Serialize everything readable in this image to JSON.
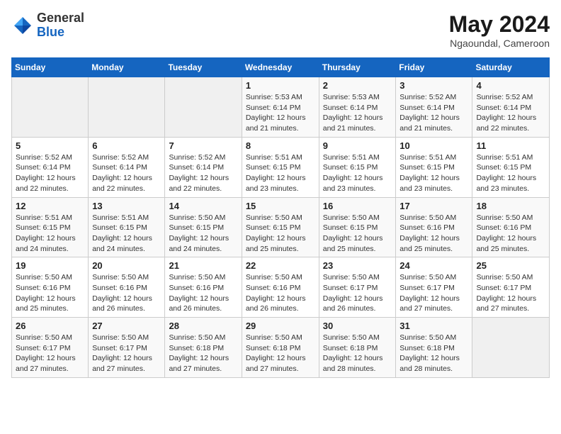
{
  "header": {
    "logo_general": "General",
    "logo_blue": "Blue",
    "month_year": "May 2024",
    "location": "Ngaoundal, Cameroon"
  },
  "weekdays": [
    "Sunday",
    "Monday",
    "Tuesday",
    "Wednesday",
    "Thursday",
    "Friday",
    "Saturday"
  ],
  "weeks": [
    [
      {
        "day": "",
        "info": ""
      },
      {
        "day": "",
        "info": ""
      },
      {
        "day": "",
        "info": ""
      },
      {
        "day": "1",
        "info": "Sunrise: 5:53 AM\nSunset: 6:14 PM\nDaylight: 12 hours\nand 21 minutes."
      },
      {
        "day": "2",
        "info": "Sunrise: 5:53 AM\nSunset: 6:14 PM\nDaylight: 12 hours\nand 21 minutes."
      },
      {
        "day": "3",
        "info": "Sunrise: 5:52 AM\nSunset: 6:14 PM\nDaylight: 12 hours\nand 21 minutes."
      },
      {
        "day": "4",
        "info": "Sunrise: 5:52 AM\nSunset: 6:14 PM\nDaylight: 12 hours\nand 22 minutes."
      }
    ],
    [
      {
        "day": "5",
        "info": "Sunrise: 5:52 AM\nSunset: 6:14 PM\nDaylight: 12 hours\nand 22 minutes."
      },
      {
        "day": "6",
        "info": "Sunrise: 5:52 AM\nSunset: 6:14 PM\nDaylight: 12 hours\nand 22 minutes."
      },
      {
        "day": "7",
        "info": "Sunrise: 5:52 AM\nSunset: 6:14 PM\nDaylight: 12 hours\nand 22 minutes."
      },
      {
        "day": "8",
        "info": "Sunrise: 5:51 AM\nSunset: 6:15 PM\nDaylight: 12 hours\nand 23 minutes."
      },
      {
        "day": "9",
        "info": "Sunrise: 5:51 AM\nSunset: 6:15 PM\nDaylight: 12 hours\nand 23 minutes."
      },
      {
        "day": "10",
        "info": "Sunrise: 5:51 AM\nSunset: 6:15 PM\nDaylight: 12 hours\nand 23 minutes."
      },
      {
        "day": "11",
        "info": "Sunrise: 5:51 AM\nSunset: 6:15 PM\nDaylight: 12 hours\nand 23 minutes."
      }
    ],
    [
      {
        "day": "12",
        "info": "Sunrise: 5:51 AM\nSunset: 6:15 PM\nDaylight: 12 hours\nand 24 minutes."
      },
      {
        "day": "13",
        "info": "Sunrise: 5:51 AM\nSunset: 6:15 PM\nDaylight: 12 hours\nand 24 minutes."
      },
      {
        "day": "14",
        "info": "Sunrise: 5:50 AM\nSunset: 6:15 PM\nDaylight: 12 hours\nand 24 minutes."
      },
      {
        "day": "15",
        "info": "Sunrise: 5:50 AM\nSunset: 6:15 PM\nDaylight: 12 hours\nand 25 minutes."
      },
      {
        "day": "16",
        "info": "Sunrise: 5:50 AM\nSunset: 6:15 PM\nDaylight: 12 hours\nand 25 minutes."
      },
      {
        "day": "17",
        "info": "Sunrise: 5:50 AM\nSunset: 6:16 PM\nDaylight: 12 hours\nand 25 minutes."
      },
      {
        "day": "18",
        "info": "Sunrise: 5:50 AM\nSunset: 6:16 PM\nDaylight: 12 hours\nand 25 minutes."
      }
    ],
    [
      {
        "day": "19",
        "info": "Sunrise: 5:50 AM\nSunset: 6:16 PM\nDaylight: 12 hours\nand 25 minutes."
      },
      {
        "day": "20",
        "info": "Sunrise: 5:50 AM\nSunset: 6:16 PM\nDaylight: 12 hours\nand 26 minutes."
      },
      {
        "day": "21",
        "info": "Sunrise: 5:50 AM\nSunset: 6:16 PM\nDaylight: 12 hours\nand 26 minutes."
      },
      {
        "day": "22",
        "info": "Sunrise: 5:50 AM\nSunset: 6:16 PM\nDaylight: 12 hours\nand 26 minutes."
      },
      {
        "day": "23",
        "info": "Sunrise: 5:50 AM\nSunset: 6:17 PM\nDaylight: 12 hours\nand 26 minutes."
      },
      {
        "day": "24",
        "info": "Sunrise: 5:50 AM\nSunset: 6:17 PM\nDaylight: 12 hours\nand 27 minutes."
      },
      {
        "day": "25",
        "info": "Sunrise: 5:50 AM\nSunset: 6:17 PM\nDaylight: 12 hours\nand 27 minutes."
      }
    ],
    [
      {
        "day": "26",
        "info": "Sunrise: 5:50 AM\nSunset: 6:17 PM\nDaylight: 12 hours\nand 27 minutes."
      },
      {
        "day": "27",
        "info": "Sunrise: 5:50 AM\nSunset: 6:17 PM\nDaylight: 12 hours\nand 27 minutes."
      },
      {
        "day": "28",
        "info": "Sunrise: 5:50 AM\nSunset: 6:18 PM\nDaylight: 12 hours\nand 27 minutes."
      },
      {
        "day": "29",
        "info": "Sunrise: 5:50 AM\nSunset: 6:18 PM\nDaylight: 12 hours\nand 27 minutes."
      },
      {
        "day": "30",
        "info": "Sunrise: 5:50 AM\nSunset: 6:18 PM\nDaylight: 12 hours\nand 28 minutes."
      },
      {
        "day": "31",
        "info": "Sunrise: 5:50 AM\nSunset: 6:18 PM\nDaylight: 12 hours\nand 28 minutes."
      },
      {
        "day": "",
        "info": ""
      }
    ]
  ]
}
